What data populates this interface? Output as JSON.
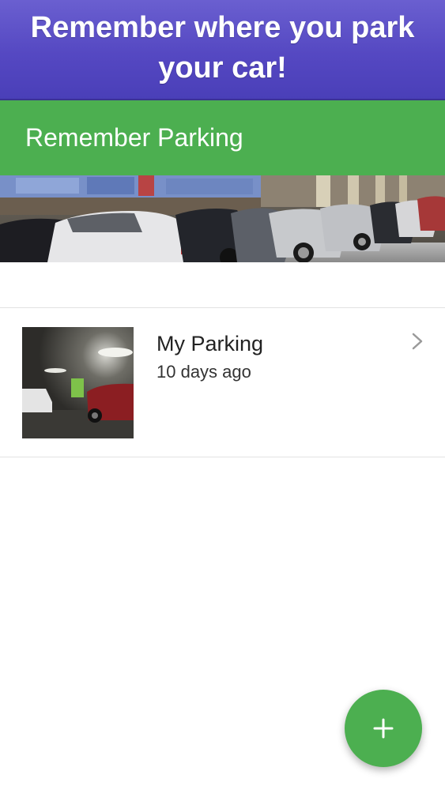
{
  "promo": {
    "headline": "Remember where you park your car!"
  },
  "app_bar": {
    "title": "Remember Parking"
  },
  "parking_list": [
    {
      "title": "My Parking",
      "subtitle": "10 days ago"
    }
  ],
  "icons": {
    "list_item_arrow": "chevron-right-icon",
    "add_button": "plus-icon"
  },
  "colors": {
    "banner_purple": "#5548c2",
    "accent_green": "#4caf50",
    "white": "#ffffff"
  }
}
